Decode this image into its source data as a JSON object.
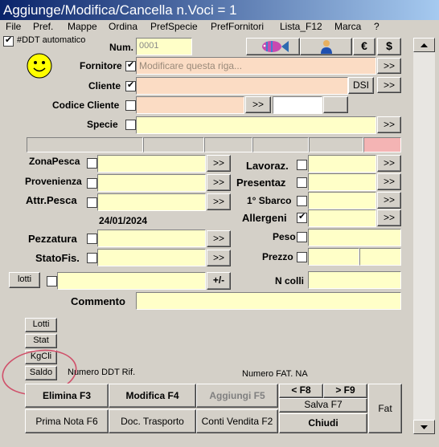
{
  "window": {
    "title": "Aggiunge/Modifica/Cancella n.Voci = 1"
  },
  "menu": [
    "File",
    "Pref.",
    "Mappe",
    "Ordina",
    "PrefSpecie",
    "PrefFornitori",
    "Lista_F12",
    "Marca",
    "?"
  ],
  "ddt_auto": {
    "label": "#DDT automatico",
    "checked": true
  },
  "num": {
    "label": "Num.",
    "value": "0001"
  },
  "toolbar": {
    "euro": "€",
    "dollar": "$"
  },
  "fornitore": {
    "label": "Fornitore",
    "checked": true,
    "placeholder": "Modificare questa riga..."
  },
  "cliente": {
    "label": "Cliente",
    "checked": true,
    "dsi": "DSI"
  },
  "codice_cliente": {
    "label": "Codice Cliente",
    "checked": false
  },
  "specie": {
    "label": "Specie",
    "checked": false
  },
  "common": {
    "more": ">>"
  },
  "left_fields": [
    {
      "label": "ZonaPesca",
      "checked": false
    },
    {
      "label": "Provenienza",
      "checked": false
    },
    {
      "label": "Attr.Pesca",
      "checked": false
    }
  ],
  "right_fields": [
    {
      "label": "Lavoraz.",
      "checked": false
    },
    {
      "label": "Presentaz",
      "checked": false
    },
    {
      "label": "1° Sbarco",
      "checked": false
    },
    {
      "label": "Allergeni",
      "checked": true
    }
  ],
  "date": "24/01/2024",
  "pezzatura": {
    "label": "Pezzatura",
    "checked": false
  },
  "stato_fis": {
    "label": "StatoFis.",
    "checked": false
  },
  "peso": {
    "label": "Peso",
    "checked": false
  },
  "prezzo": {
    "label": "Prezzo",
    "checked": false
  },
  "lotti_row": {
    "button": "lotti",
    "plusminus": "+/-",
    "ncolli_label": "N colli"
  },
  "commento": {
    "label": "Commento"
  },
  "side_buttons": [
    "Lotti",
    "Stat",
    "KgCli",
    "Saldo"
  ],
  "numero_ddt": "Numero DDT Rif.",
  "numero_fat": "Numero FAT. NA",
  "actions": {
    "elimina": "Elimina F3",
    "modifica": "Modifica F4",
    "aggiungi": "Aggiungi F5",
    "prev": "< F8",
    "next": "> F9",
    "salva": "Salva F7",
    "chiudi": "Chiudi",
    "fat": "Fat",
    "prima_nota": "Prima Nota F6",
    "doc_trasporto": "Doc. Trasporto",
    "conti_vendita": "Conti Vendita F2"
  },
  "colors": {
    "field_yellow": "#ffffc8",
    "field_peach": "#fbdcc4",
    "highlight_circle": "#d0506a"
  }
}
